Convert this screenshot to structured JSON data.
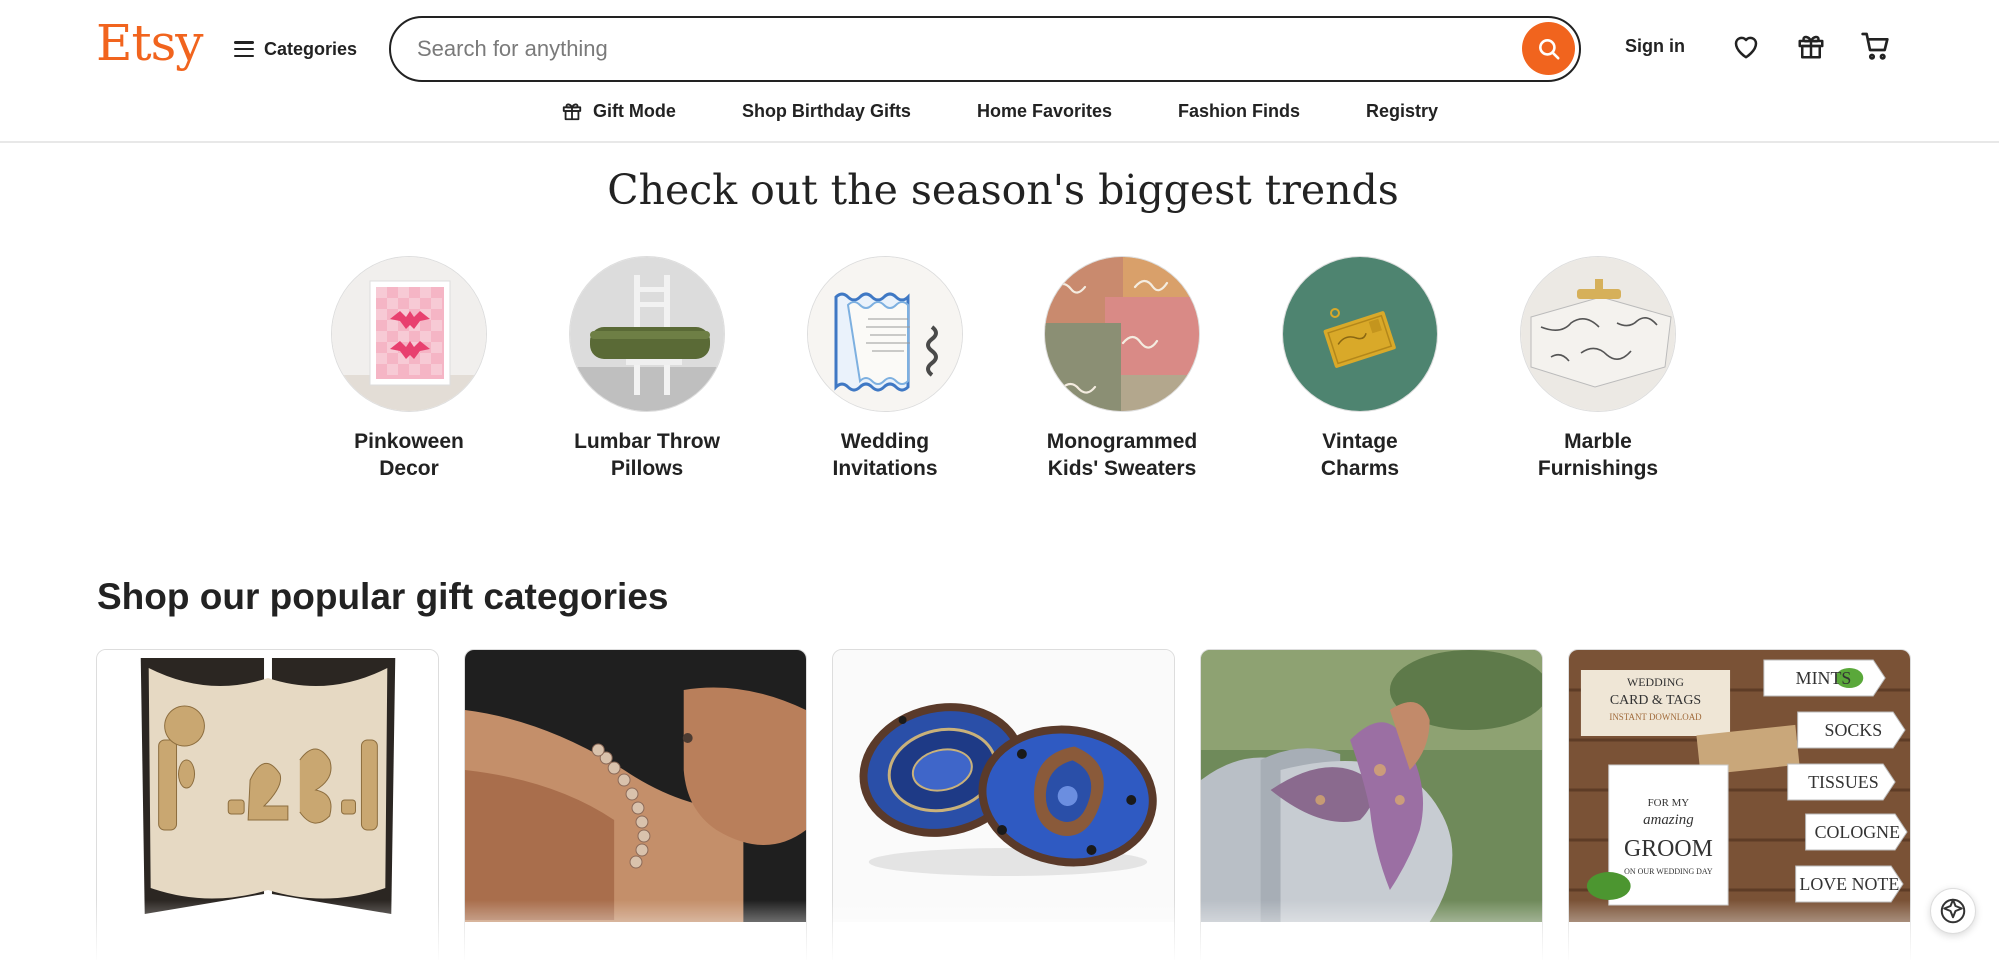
{
  "header": {
    "logo": "Etsy",
    "categories_label": "Categories",
    "search_placeholder": "Search for anything",
    "search_value": "",
    "sign_in": "Sign in"
  },
  "subnav": [
    {
      "label": "Gift Mode",
      "icon": "gift-icon"
    },
    {
      "label": "Shop Birthday Gifts"
    },
    {
      "label": "Home Favorites"
    },
    {
      "label": "Fashion Finds"
    },
    {
      "label": "Registry"
    }
  ],
  "trends": {
    "title": "Check out the season's biggest trends",
    "items": [
      {
        "line1": "Pinkoween",
        "line2": "Decor"
      },
      {
        "line1": "Lumbar Throw",
        "line2": "Pillows"
      },
      {
        "line1": "Wedding",
        "line2": "Invitations"
      },
      {
        "line1": "Monogrammed",
        "line2": "Kids' Sweaters"
      },
      {
        "line1": "Vintage",
        "line2": "Charms"
      },
      {
        "line1": "Marble",
        "line2": "Furnishings"
      }
    ]
  },
  "gifts": {
    "title": "Shop our popular gift categories",
    "cards": [
      {
        "image": "folded-book-art"
      },
      {
        "image": "beaded-bracelet"
      },
      {
        "image": "beaded-earrings"
      },
      {
        "image": "felt-bird-ornament"
      },
      {
        "image": "wedding-tags",
        "overlay": [
          "WEDDING",
          "CARD & TAGS",
          "INSTANT DOWNLOAD",
          "MINTS",
          "SOCKS",
          "TISSUES",
          "COLOGNE",
          "LOVE NOTE",
          "FOR MY",
          "amazing",
          "GROOM",
          "ON OUR WEDDING DAY"
        ]
      }
    ]
  },
  "colors": {
    "brand": "#F1641E",
    "text": "#222222"
  }
}
